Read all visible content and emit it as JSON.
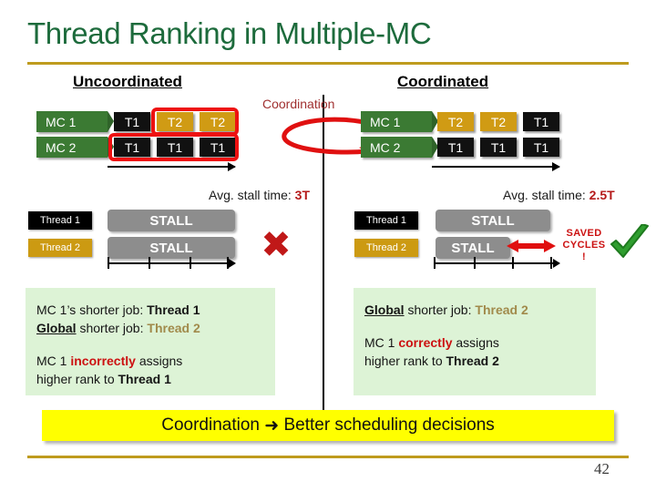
{
  "slide": {
    "title": "Thread Ranking in Multiple-MC",
    "page_number": "42",
    "accent_rule_color": "#bf9b1e",
    "title_color": "#1d6b3c"
  },
  "columns": {
    "left_heading": "Uncoordinated",
    "right_heading": "Coordinated"
  },
  "coordination_annotation": {
    "label": "Coordination",
    "color": "#a03030"
  },
  "uncoordinated": {
    "rows": [
      {
        "name": "MC 1",
        "jobs": [
          {
            "label": "T1",
            "thread": "t1",
            "highlighted": false
          },
          {
            "label": "T2",
            "thread": "t2",
            "highlighted": true
          },
          {
            "label": "T2",
            "thread": "t2",
            "highlighted": true
          }
        ]
      },
      {
        "name": "MC 2",
        "jobs": [
          {
            "label": "T1",
            "thread": "t1",
            "highlighted": true
          },
          {
            "label": "T1",
            "thread": "t1",
            "highlighted": true
          },
          {
            "label": "T1",
            "thread": "t1",
            "highlighted": true
          }
        ]
      }
    ],
    "avg_stall_prefix": "Avg. stall time: ",
    "avg_stall_value": "3T",
    "threads": [
      {
        "label": "Thread 1",
        "thread": "t1"
      },
      {
        "label": "Thread 2",
        "thread": "t2"
      }
    ],
    "stall_bars": [
      {
        "label": "STALL",
        "thread": "t1",
        "length_units": 3
      },
      {
        "label": "STALL",
        "thread": "t2",
        "length_units": 3
      }
    ],
    "verdict_icon": "cross-mark-icon",
    "panel_lines": [
      {
        "segments": [
          {
            "text": "MC 1’s shorter job: ",
            "style": "plain"
          },
          {
            "text": "Thread 1",
            "style": "bold"
          }
        ]
      },
      {
        "segments": [
          {
            "text": "Global",
            "style": "bold-underline"
          },
          {
            "text": " shorter job: ",
            "style": "plain"
          },
          {
            "text": "Thread 2",
            "style": "thread2"
          }
        ]
      },
      {
        "segments": [
          {
            "text": "MC 1 ",
            "style": "plain"
          },
          {
            "text": "incorrectly",
            "style": "red-bold"
          },
          {
            "text": " assigns",
            "style": "plain"
          }
        ]
      },
      {
        "segments": [
          {
            "text": "higher rank to ",
            "style": "plain"
          },
          {
            "text": "Thread 1",
            "style": "bold"
          }
        ]
      }
    ]
  },
  "coordinated": {
    "rows": [
      {
        "name": "MC 1",
        "jobs": [
          {
            "label": "T2",
            "thread": "t2",
            "highlighted": false
          },
          {
            "label": "T2",
            "thread": "t2",
            "highlighted": false
          },
          {
            "label": "T1",
            "thread": "t1",
            "highlighted": false
          }
        ]
      },
      {
        "name": "MC 2",
        "jobs": [
          {
            "label": "T1",
            "thread": "t1",
            "highlighted": false
          },
          {
            "label": "T1",
            "thread": "t1",
            "highlighted": false
          },
          {
            "label": "T1",
            "thread": "t1",
            "highlighted": false
          }
        ]
      }
    ],
    "avg_stall_prefix": "Avg. stall time: ",
    "avg_stall_value": "2.5T",
    "threads": [
      {
        "label": "Thread 1",
        "thread": "t1"
      },
      {
        "label": "Thread 2",
        "thread": "t2"
      }
    ],
    "stall_bars": [
      {
        "label": "STALL",
        "thread": "t1",
        "length_units": 3
      },
      {
        "label": "STALL",
        "thread": "t2",
        "length_units": 2
      }
    ],
    "saved_label_line1": "SAVED",
    "saved_label_line2": "CYCLES",
    "saved_label_line3": "!",
    "verdict_icon": "check-mark-icon",
    "panel_lines": [
      {
        "segments": [
          {
            "text": "Global",
            "style": "bold-underline"
          },
          {
            "text": " shorter job: ",
            "style": "plain"
          },
          {
            "text": "Thread 2",
            "style": "thread2"
          }
        ]
      },
      {
        "segments": [
          {
            "text": "MC 1 ",
            "style": "plain"
          },
          {
            "text": "correctly",
            "style": "red-bold"
          },
          {
            "text": " assigns",
            "style": "plain"
          }
        ]
      },
      {
        "segments": [
          {
            "text": "higher rank to ",
            "style": "plain"
          },
          {
            "text": "Thread 2",
            "style": "bold"
          }
        ]
      }
    ]
  },
  "banner": {
    "text_before": "Coordination",
    "arrow": "➜",
    "text_after": "Better scheduling decisions",
    "background": "#ffff00"
  },
  "colors": {
    "mc_green": "#3b7a33",
    "thread1_black": "#111111",
    "thread2_gold": "#d09b14",
    "stall_gray": "#8d8d8d",
    "highlight_red": "#ee1111",
    "panel_green": "#ddf3d6"
  }
}
